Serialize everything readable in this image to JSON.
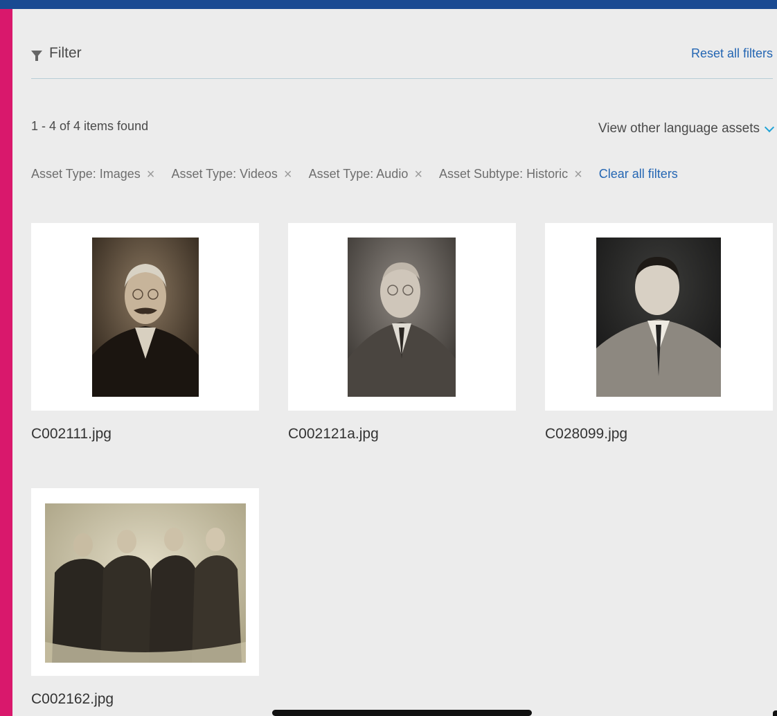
{
  "filter": {
    "label": "Filter",
    "reset_label": "Reset all filters"
  },
  "results": {
    "count_text": "1 - 4 of 4 items found",
    "language_toggle": "View other language assets"
  },
  "active_filters": [
    {
      "label": "Asset Type: Images"
    },
    {
      "label": "Asset Type: Videos"
    },
    {
      "label": "Asset Type: Audio"
    },
    {
      "label": "Asset Subtype: Historic"
    }
  ],
  "chip_remove_glyph": "×",
  "clear_all_label": "Clear all filters",
  "assets": [
    {
      "filename": "C002111.jpg"
    },
    {
      "filename": "C002121a.jpg"
    },
    {
      "filename": "C028099.jpg"
    },
    {
      "filename": "C002162.jpg"
    }
  ],
  "colors": {
    "top_bar": "#1a4a92",
    "side_bar": "#d9186c",
    "link": "#2466b3",
    "accent_chevron": "#1fa3d6",
    "background": "#ececec"
  },
  "icons": {
    "filter": "filter-funnel-icon",
    "language_toggle": "chevron-down-icon",
    "chip_remove": "close-icon"
  }
}
